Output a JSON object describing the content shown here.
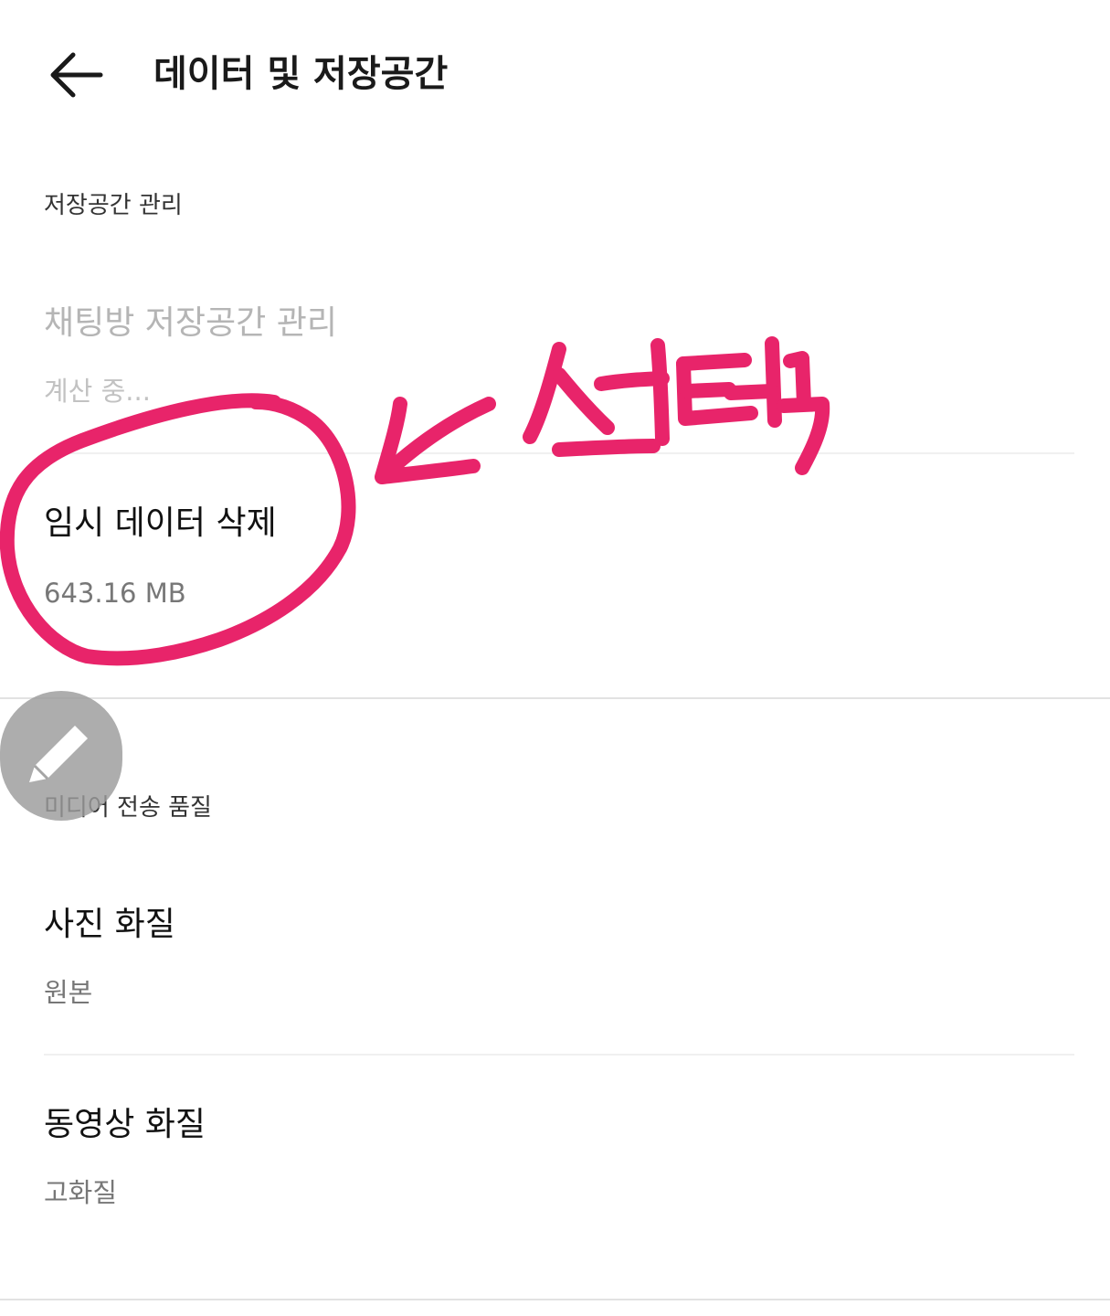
{
  "header": {
    "back_icon": "arrow-left-icon",
    "title": "데이터 및 저장공간"
  },
  "sections": {
    "storage": {
      "header": "저장공간 관리",
      "items": [
        {
          "title": "채팅방 저장공간 관리",
          "subtitle": "계산 중...",
          "disabled": true
        },
        {
          "title": "임시 데이터 삭제",
          "subtitle": "643.16 MB",
          "disabled": false
        }
      ]
    },
    "media": {
      "header": "미디어 전송 품질",
      "items": [
        {
          "title": "사진 화질",
          "subtitle": "원본"
        },
        {
          "title": "동영상 화질",
          "subtitle": "고화질"
        }
      ]
    }
  },
  "annotation": {
    "text": "선택",
    "color": "#E8246A"
  },
  "fab": {
    "icon": "pencil-icon",
    "color": "#9B9B9B"
  }
}
